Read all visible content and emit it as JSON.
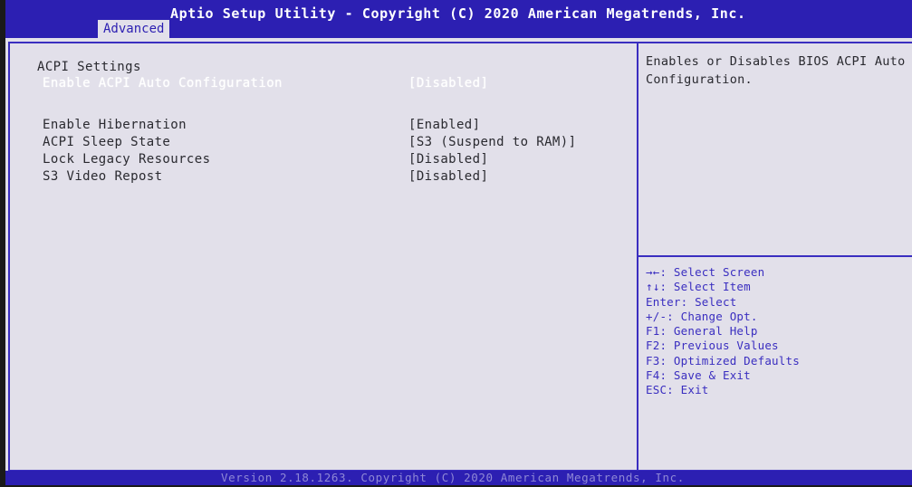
{
  "header": {
    "title": "Aptio Setup Utility - Copyright (C) 2020 American Megatrends, Inc.",
    "tab_label": "Advanced"
  },
  "main": {
    "section_title": "ACPI Settings",
    "settings": [
      {
        "label": "Enable ACPI Auto Configuration",
        "value": "[Disabled]",
        "selected": true
      },
      {
        "label": "Enable Hibernation",
        "value": "[Enabled]"
      },
      {
        "label": "ACPI Sleep State",
        "value": "[S3 (Suspend to RAM)]"
      },
      {
        "label": "Lock Legacy Resources",
        "value": "[Disabled]"
      },
      {
        "label": "S3 Video Repost",
        "value": "[Disabled]"
      }
    ]
  },
  "help": {
    "text": "Enables or Disables BIOS ACPI Auto Configuration."
  },
  "keys": [
    "→←: Select Screen",
    "↑↓: Select Item",
    "Enter: Select",
    "+/-: Change Opt.",
    "F1: General Help",
    "F2: Previous Values",
    "F3: Optimized Defaults",
    "F4: Save & Exit",
    "ESC: Exit"
  ],
  "footer": {
    "version": "Version 2.18.1263. Copyright (C) 2020 American Megatrends, Inc."
  },
  "colors": {
    "bar_blue": "#2c1fb2",
    "panel_background": "#e2e0ea",
    "border_blue": "#3a2ec0",
    "text_dark": "#2a2a30",
    "selected_text": "#ffffff"
  }
}
